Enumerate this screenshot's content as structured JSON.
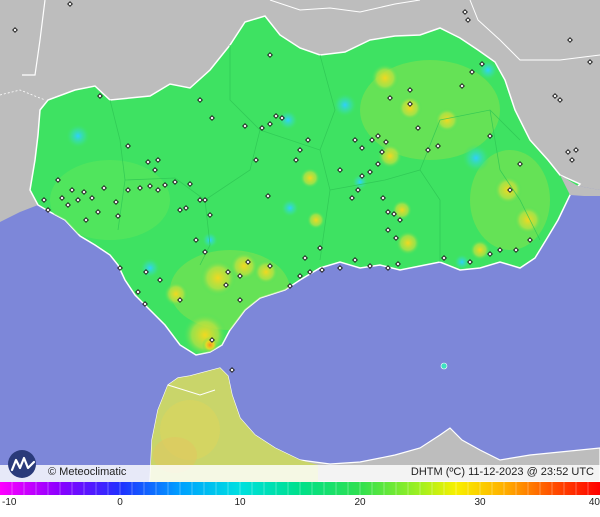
{
  "map": {
    "credit": "© Meteoclimatic",
    "title": "DHTM (ºC)  11-12-2023 @ 23:52 UTC",
    "colors": {
      "sea": "#7d87d9",
      "land_outside": "#bdbdbd",
      "region_base": "#3ee262",
      "morocco": "#c9d56a",
      "border": "#ffffff"
    }
  },
  "legend": {
    "tick_labels": [
      "-10",
      "0",
      "10",
      "20",
      "30",
      "40"
    ],
    "ticks": [
      -10,
      0,
      10,
      20,
      30,
      40
    ],
    "range": [
      -10,
      40
    ]
  }
}
